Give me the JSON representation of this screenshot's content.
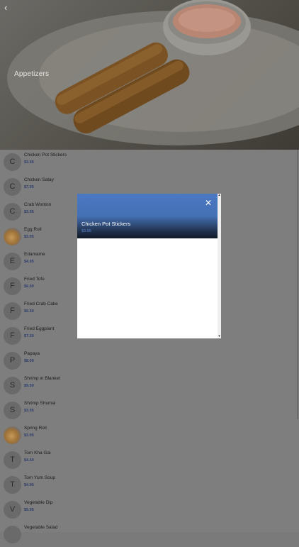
{
  "header": {
    "title": "Appetizers",
    "back_icon": "chevron-left-icon"
  },
  "items": [
    {
      "initial": "C",
      "name": "Chicken Pot Stickers",
      "price": "$3.95",
      "has_image": false
    },
    {
      "initial": "C",
      "name": "Chicken Satay",
      "price": "$7.95",
      "has_image": false
    },
    {
      "initial": "C",
      "name": "Crab Wonton",
      "price": "$3.95",
      "has_image": false
    },
    {
      "initial": "",
      "name": "Egg Roll",
      "price": "$3.95",
      "has_image": true
    },
    {
      "initial": "E",
      "name": "Edamame",
      "price": "$4.95",
      "has_image": false
    },
    {
      "initial": "F",
      "name": "Fried Tofu",
      "price": "$6.50",
      "has_image": false
    },
    {
      "initial": "F",
      "name": "Fried Crab Cake",
      "price": "$6.50",
      "has_image": false
    },
    {
      "initial": "F",
      "name": "Fried Eggplant",
      "price": "$7.50",
      "has_image": false
    },
    {
      "initial": "P",
      "name": "Papaya",
      "price": "$8.00",
      "has_image": false
    },
    {
      "initial": "S",
      "name": "Shrimp in Blanket",
      "price": "$9.50",
      "has_image": false
    },
    {
      "initial": "S",
      "name": "Shrimp Shumai",
      "price": "$3.95",
      "has_image": false
    },
    {
      "initial": "",
      "name": "Spring Roll",
      "price": "$3.95",
      "has_image": true
    },
    {
      "initial": "T",
      "name": "Tom Kha Gai",
      "price": "$4.50",
      "has_image": false
    },
    {
      "initial": "T",
      "name": "Tom Yum Soup",
      "price": "$4.95",
      "has_image": false
    },
    {
      "initial": "V",
      "name": "Vegetable Dip",
      "price": "$5.95",
      "has_image": false
    },
    {
      "initial": "",
      "name": "Vegetable Salad",
      "price": "",
      "has_image": false
    }
  ],
  "modal": {
    "title": "Chicken Pot Stickers",
    "price": "$3.95",
    "close_icon": "close-icon"
  },
  "colors": {
    "price": "#2e3e6e",
    "modal_header": "#4a78c2"
  }
}
